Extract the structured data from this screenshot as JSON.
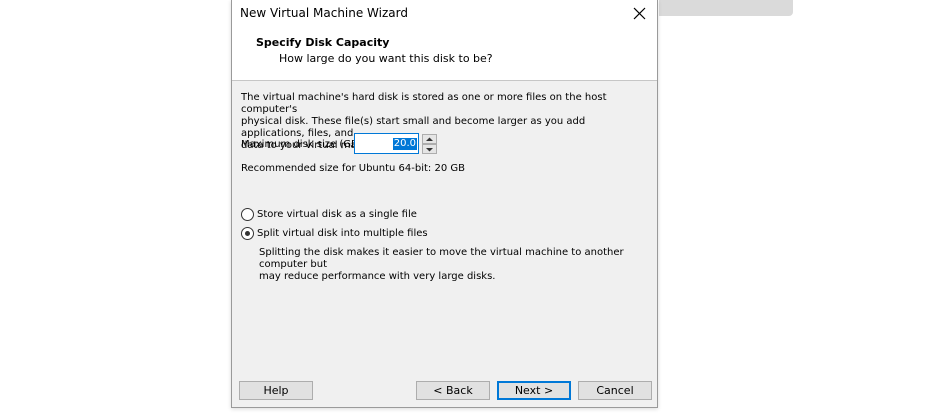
{
  "window": {
    "title": "New Virtual Machine Wizard"
  },
  "header": {
    "title": "Specify Disk Capacity",
    "subtitle": "How large do you want this disk to be?"
  },
  "description": "The virtual machine's hard disk is stored as one or more files on the host computer's\nphysical disk. These file(s) start small and become larger as you add applications, files, and\ndata to your virtual machine.",
  "disk_size": {
    "label": "Maximum disk size (GB):",
    "value": "20.0"
  },
  "recommended": "Recommended size for Ubuntu 64-bit: 20 GB",
  "options": {
    "single_file": {
      "label": "Store virtual disk as a single file",
      "selected": false
    },
    "multiple_files": {
      "label": "Split virtual disk into multiple files",
      "selected": true,
      "description": "Splitting the disk makes it easier to move the virtual machine to another computer but\nmay reduce performance with very large disks."
    }
  },
  "buttons": {
    "help": "Help",
    "back": "< Back",
    "next": "Next >",
    "cancel": "Cancel"
  },
  "colors": {
    "accent": "#0078d7",
    "dialog_bg": "#f0f0f0",
    "button_bg": "#e1e1e1"
  },
  "icons": {
    "close": "close-icon",
    "spin_up": "arrow-up-icon",
    "spin_down": "arrow-down-icon"
  }
}
